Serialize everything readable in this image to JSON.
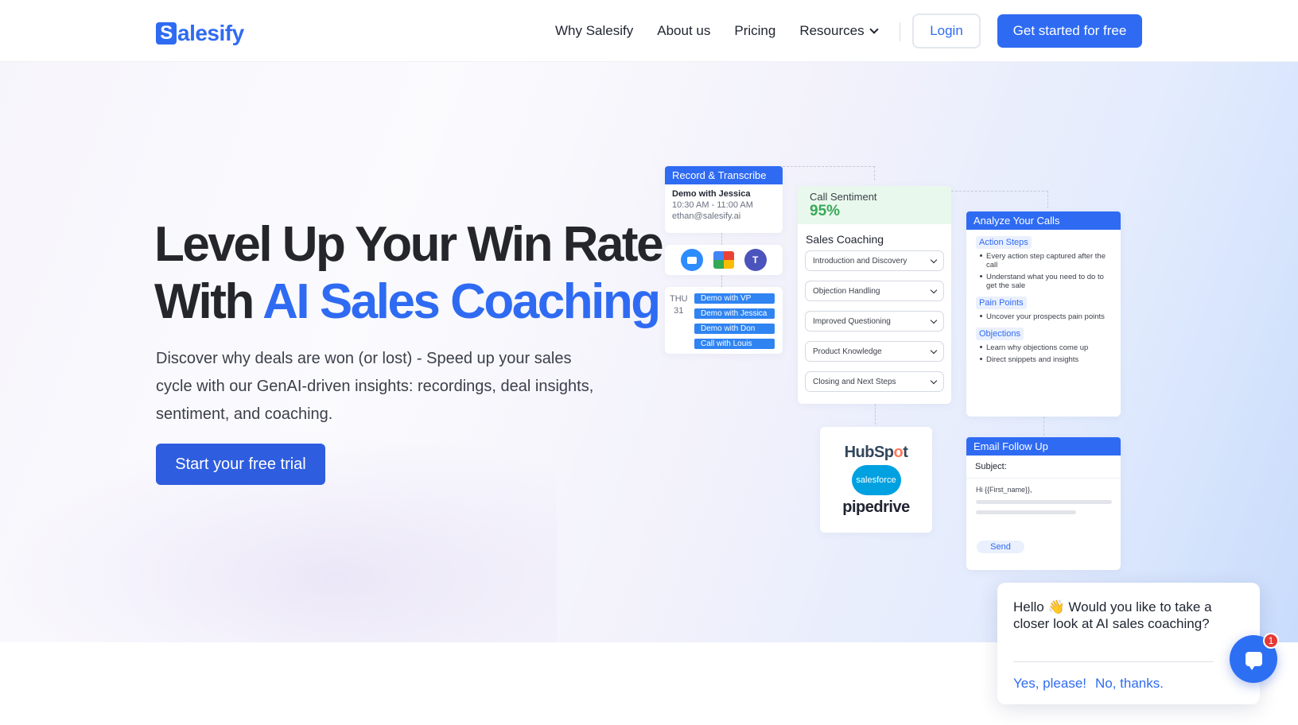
{
  "nav": {
    "logo_letter": "S",
    "logo_rest": "alesify",
    "links": [
      "Why Salesify",
      "About us",
      "Pricing",
      "Resources"
    ],
    "login": "Login",
    "get_started": "Get started for free"
  },
  "hero": {
    "title_line1": "Level Up Your Win Rate",
    "title_line2_plain": "With",
    "title_line2_accent": "AI Sales Coaching",
    "subtitle": "Discover why deals are won (or lost) - Speed up your sales cycle with our GenAI-driven insights: recordings, deal insights, sentiment, and coaching.",
    "cta": "Start your free trial"
  },
  "mockup": {
    "record": {
      "title": "Record & Transcribe",
      "meeting": "Demo with Jessica",
      "time": "10:30 AM - 11:00 AM",
      "email": "ethan@salesify.ai"
    },
    "apps": [
      "zoom-icon",
      "google-meet-icon",
      "teams-icon"
    ],
    "calendar": {
      "day": "THU",
      "date": "31",
      "events": [
        "Demo with VP",
        "Demo with Jessica",
        "Demo with Don",
        "Call with Louis"
      ]
    },
    "sentiment": {
      "label": "Call Sentiment",
      "value": "95%",
      "coaching_title": "Sales Coaching",
      "items": [
        "Introduction and Discovery",
        "Objection Handling",
        "Improved Questioning",
        "Product Knowledge",
        "Closing and Next Steps"
      ]
    },
    "analyze": {
      "title": "Analyze Your Calls",
      "sections": [
        {
          "tag": "Action Steps",
          "bullets": [
            "Every action step captured after the call",
            "Understand what you need to do to get the sale"
          ]
        },
        {
          "tag": "Pain Points",
          "bullets": [
            "Uncover your prospects pain points"
          ]
        },
        {
          "tag": "Objections",
          "bullets": [
            "Learn why objections come up",
            "Direct snippets and insights"
          ]
        }
      ]
    },
    "crm": {
      "hubspot_a": "HubSp",
      "hubspot_o": "o",
      "hubspot_b": "t",
      "salesforce": "salesforce",
      "pipedrive": "pipedrive"
    },
    "email": {
      "title": "Email Follow Up",
      "subject": "Subject:",
      "greeting": "Hi {{First_name}},",
      "send": "Send"
    }
  },
  "chat": {
    "greeting_a": "Hello",
    "wave": "👋",
    "greeting_b": "Would you like to take a closer look at AI sales coaching?",
    "yes": "Yes, please!",
    "no": "No, thanks.",
    "badge": "1"
  },
  "colors": {
    "brand": "#2f6bf2",
    "positive": "#38a85a"
  }
}
